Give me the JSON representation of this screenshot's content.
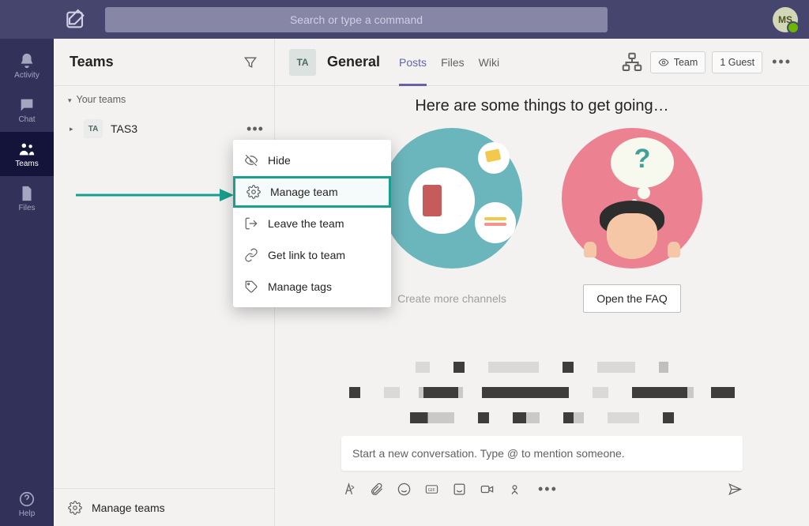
{
  "top": {
    "search_placeholder": "Search or type a command",
    "user_initials": "MS"
  },
  "rail": [
    {
      "id": "activity",
      "label": "Activity"
    },
    {
      "id": "chat",
      "label": "Chat"
    },
    {
      "id": "teams",
      "label": "Teams",
      "active": true
    },
    {
      "id": "files",
      "label": "Files"
    },
    {
      "id": "help",
      "label": "Help"
    }
  ],
  "sidebar": {
    "title": "Teams",
    "group_label": "Your teams",
    "teams": [
      {
        "badge": "TA",
        "name": "TAS3"
      }
    ],
    "footer": "Manage teams"
  },
  "ctxmenu": {
    "items": [
      {
        "id": "hide",
        "label": "Hide"
      },
      {
        "id": "manage",
        "label": "Manage team",
        "highlight": true
      },
      {
        "id": "leave",
        "label": "Leave the team"
      },
      {
        "id": "link",
        "label": "Get link to team"
      },
      {
        "id": "tags",
        "label": "Manage tags"
      }
    ]
  },
  "channel": {
    "badge": "TA",
    "title": "General",
    "tabs": [
      {
        "id": "posts",
        "label": "Posts",
        "active": true
      },
      {
        "id": "files",
        "label": "Files"
      },
      {
        "id": "wiki",
        "label": "Wiki"
      }
    ],
    "visibility_label": "Team",
    "guest_label": "1 Guest"
  },
  "hero": {
    "heading": "Here are some things to get going…",
    "cta_channels": "Create more channels",
    "cta_faq": "Open the FAQ"
  },
  "composer": {
    "placeholder": "Start a new conversation. Type @ to mention someone."
  }
}
